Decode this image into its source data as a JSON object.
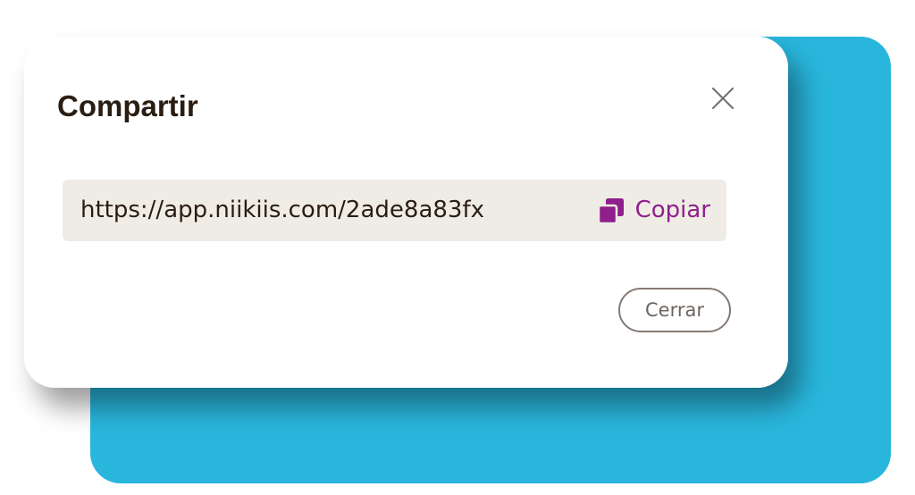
{
  "dialog": {
    "title": "Compartir",
    "close_icon": "close-icon",
    "link": {
      "url": "https://app.niikiis.com/2ade8a83fx",
      "copy_label": "Copiar",
      "copy_icon": "copy-icon"
    },
    "close_button_label": "Cerrar"
  },
  "colors": {
    "backdrop": "#29b6dd",
    "dialog_background": "#ffffff",
    "title_text": "#2a1d12",
    "link_box_background": "#efece6",
    "accent": "#8e1f8c",
    "button_border": "#857a74",
    "button_text": "#6d6460"
  }
}
